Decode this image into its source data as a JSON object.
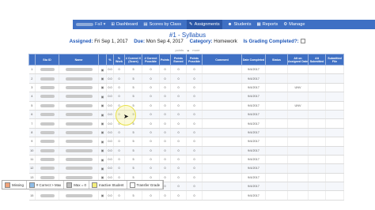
{
  "nav": {
    "term": "Fall",
    "items": [
      {
        "label": "Dashboard",
        "icon": "⊞",
        "name": "dashboard"
      },
      {
        "label": "Scores by Class",
        "icon": "▤",
        "name": "scores-by-class"
      },
      {
        "label": "Assignments",
        "icon": "✎",
        "name": "assignments",
        "active": true
      },
      {
        "label": "Students",
        "icon": "☻",
        "name": "students"
      },
      {
        "label": "Reports",
        "icon": "▦",
        "name": "reports"
      },
      {
        "label": "Manage",
        "icon": "⚙",
        "name": "manage"
      }
    ]
  },
  "assignment": {
    "title": "#1 - Syllabus",
    "assigned_label": "Assigned:",
    "assigned_value": "Fri Sep 1, 2017",
    "due_label": "Due:",
    "due_value": "Mon Sep 4, 2017",
    "category_label": "Category:",
    "category_value": "Homework",
    "grading_label": "Is Grading Completed?:",
    "pager_left": "points",
    "pager_right": "more"
  },
  "table": {
    "headers": [
      "",
      "Stu ID",
      "Name",
      "",
      "%",
      "% Work",
      "# Correct X (Score)",
      "# Correct Possible",
      "Points",
      "Points Earned",
      "Points Possible",
      "Comment",
      "Date Completed",
      "Status",
      "Alt on Assigned Date",
      "Alt Submitted",
      "Submitted File"
    ],
    "rows": [
      {
        "n": "1",
        "pct": "0.0",
        "work": "0",
        "cor": "5",
        "pos": "0",
        "pts": "0",
        "earned": "0",
        "possible": "0",
        "date": "9/4/2017",
        "alt": ""
      },
      {
        "n": "2",
        "pct": "0.0",
        "work": "0",
        "cor": "5",
        "pos": "0",
        "pts": "0",
        "earned": "0",
        "possible": "0",
        "date": "9/4/2017",
        "alt": ""
      },
      {
        "n": "3",
        "pct": "0.0",
        "work": "0",
        "cor": "5",
        "pos": "0",
        "pts": "0",
        "earned": "0",
        "possible": "0",
        "date": "9/4/2017",
        "alt": "UNV"
      },
      {
        "n": "4",
        "pct": "0.0",
        "work": "0",
        "cor": "5",
        "pos": "0",
        "pts": "0",
        "earned": "0",
        "possible": "0",
        "date": "9/4/2017",
        "alt": ""
      },
      {
        "n": "5",
        "pct": "0.0",
        "work": "0",
        "cor": "5",
        "pos": "0",
        "pts": "0",
        "earned": "0",
        "possible": "0",
        "date": "9/4/2017",
        "alt": "UNV"
      },
      {
        "n": "6",
        "pct": "0.0",
        "work": "0",
        "cor": "5",
        "pos": "0",
        "pts": "0",
        "earned": "0",
        "possible": "0",
        "date": "9/4/2017",
        "alt": ""
      },
      {
        "n": "7",
        "pct": "0.0",
        "work": "0",
        "cor": "5",
        "pos": "0",
        "pts": "0",
        "earned": "0",
        "possible": "0",
        "date": "9/4/2017",
        "alt": ""
      },
      {
        "n": "8",
        "pct": "0.0",
        "work": "0",
        "cor": "5",
        "pos": "0",
        "pts": "0",
        "earned": "0",
        "possible": "0",
        "date": "9/4/2017",
        "alt": ""
      },
      {
        "n": "9",
        "pct": "0.0",
        "work": "0",
        "cor": "5",
        "pos": "0",
        "pts": "0",
        "earned": "0",
        "possible": "0",
        "date": "9/4/2017",
        "alt": ""
      },
      {
        "n": "10",
        "pct": "0.0",
        "work": "0",
        "cor": "5",
        "pos": "0",
        "pts": "0",
        "earned": "0",
        "possible": "0",
        "date": "9/4/2017",
        "alt": ""
      },
      {
        "n": "11",
        "pct": "0.0",
        "work": "0",
        "cor": "5",
        "pos": "0",
        "pts": "0",
        "earned": "0",
        "possible": "0",
        "date": "9/4/2017",
        "alt": ""
      },
      {
        "n": "12",
        "pct": "0.0",
        "work": "0",
        "cor": "5",
        "pos": "0",
        "pts": "0",
        "earned": "0",
        "possible": "0",
        "date": "9/4/2017",
        "alt": ""
      },
      {
        "n": "13",
        "pct": "0.0",
        "work": "0",
        "cor": "5",
        "pos": "0",
        "pts": "0",
        "earned": "0",
        "possible": "0",
        "date": "9/4/2017",
        "alt": ""
      },
      {
        "n": "14",
        "pct": "0.0",
        "work": "0",
        "cor": "5",
        "pos": "0",
        "pts": "0",
        "earned": "0",
        "possible": "0",
        "date": "9/4/2017",
        "alt": ""
      },
      {
        "n": "15",
        "pct": "0.0",
        "work": "0",
        "cor": "5",
        "pos": "0",
        "pts": "0",
        "earned": "0",
        "possible": "0",
        "date": "9/4/2017",
        "alt": ""
      }
    ]
  },
  "legend": [
    {
      "label": "Missing",
      "color": "#f0a27a",
      "name": "missing"
    },
    {
      "label": "# Correct > Max",
      "color": "#8fbde8",
      "name": "correct-over-max"
    },
    {
      "label": "Max = 0",
      "color": "#bdbdbd",
      "name": "max-zero"
    },
    {
      "label": "Inactive Student",
      "color": "#f4ee7c",
      "name": "inactive-student"
    },
    {
      "label": "Transfer Grade",
      "color": "#ffffff",
      "name": "transfer-grade"
    }
  ]
}
